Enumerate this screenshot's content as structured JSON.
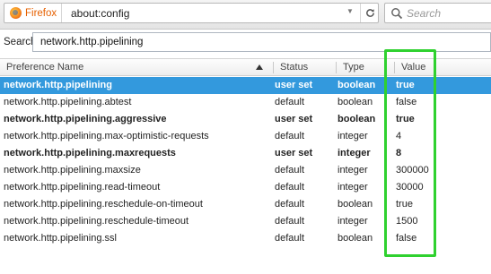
{
  "toolbar": {
    "site_label": "Firefox",
    "url": "about:config",
    "search_placeholder": "Search"
  },
  "filter": {
    "label": "Search:",
    "value": "network.http.pipelining"
  },
  "columns": {
    "name": "Preference Name",
    "status": "Status",
    "type": "Type",
    "value": "Value"
  },
  "rows": [
    {
      "name": "network.http.pipelining",
      "status": "user set",
      "type": "boolean",
      "value": "true"
    },
    {
      "name": "network.http.pipelining.abtest",
      "status": "default",
      "type": "boolean",
      "value": "false"
    },
    {
      "name": "network.http.pipelining.aggressive",
      "status": "user set",
      "type": "boolean",
      "value": "true"
    },
    {
      "name": "network.http.pipelining.max-optimistic-requests",
      "status": "default",
      "type": "integer",
      "value": "4"
    },
    {
      "name": "network.http.pipelining.maxrequests",
      "status": "user set",
      "type": "integer",
      "value": "8"
    },
    {
      "name": "network.http.pipelining.maxsize",
      "status": "default",
      "type": "integer",
      "value": "300000"
    },
    {
      "name": "network.http.pipelining.read-timeout",
      "status": "default",
      "type": "integer",
      "value": "30000"
    },
    {
      "name": "network.http.pipelining.reschedule-on-timeout",
      "status": "default",
      "type": "boolean",
      "value": "true"
    },
    {
      "name": "network.http.pipelining.reschedule-timeout",
      "status": "default",
      "type": "integer",
      "value": "1500"
    },
    {
      "name": "network.http.pipelining.ssl",
      "status": "default",
      "type": "boolean",
      "value": "false"
    }
  ],
  "colors": {
    "selected_row": "#3399dd",
    "highlight_box": "#2fd12f",
    "firefox_label": "#e66000"
  },
  "icons": [
    "firefox-logo-icon",
    "dropdown-arrow-icon",
    "reload-icon",
    "search-icon",
    "sort-ascending-icon"
  ]
}
